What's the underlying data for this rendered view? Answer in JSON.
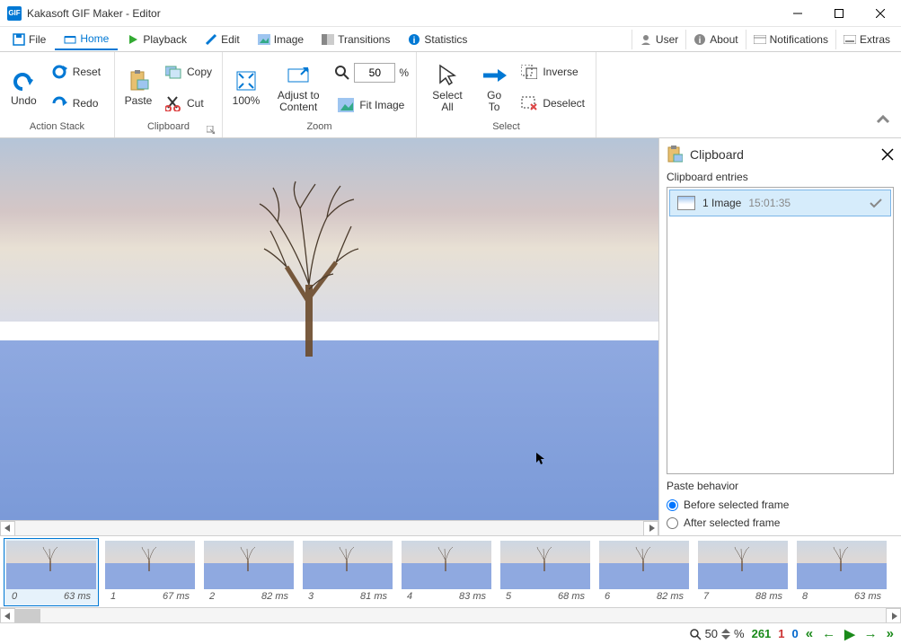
{
  "window": {
    "title": "Kakasoft GIF Maker - Editor",
    "appicon": "GIF"
  },
  "tabs": {
    "file": "File",
    "home": "Home",
    "playback": "Playback",
    "edit": "Edit",
    "image": "Image",
    "transitions": "Transitions",
    "statistics": "Statistics"
  },
  "righttabs": {
    "user": "User",
    "about": "About",
    "notifications": "Notifications",
    "extras": "Extras"
  },
  "ribbon": {
    "undo": "Undo",
    "reset": "Reset",
    "redo": "Redo",
    "actionstack": "Action Stack",
    "paste": "Paste",
    "copy": "Copy",
    "cut": "Cut",
    "clipboard": "Clipboard",
    "hundred": "100%",
    "adjust": "Adjust to Content",
    "fitimage": "Fit Image",
    "zoomval": "50",
    "pct": "%",
    "zoom": "Zoom",
    "selectall": "Select All",
    "goto": "Go To",
    "inverse": "Inverse",
    "deselect": "Deselect",
    "select": "Select"
  },
  "sidepanel": {
    "title": "Clipboard",
    "entries_label": "Clipboard entries",
    "entry_name": "1 Image",
    "entry_time": "15:01:35",
    "paste_hdr": "Paste behavior",
    "opt_before": "Before selected frame",
    "opt_after": "After selected frame"
  },
  "frames": [
    {
      "idx": "0",
      "dur": "63 ms"
    },
    {
      "idx": "1",
      "dur": "67 ms"
    },
    {
      "idx": "2",
      "dur": "82 ms"
    },
    {
      "idx": "3",
      "dur": "81 ms"
    },
    {
      "idx": "4",
      "dur": "83 ms"
    },
    {
      "idx": "5",
      "dur": "68 ms"
    },
    {
      "idx": "6",
      "dur": "82 ms"
    },
    {
      "idx": "7",
      "dur": "88 ms"
    },
    {
      "idx": "8",
      "dur": "63 ms"
    }
  ],
  "status": {
    "zoomval": "50",
    "pct": "%",
    "frames": "261",
    "one": "1",
    "zero": "0"
  }
}
